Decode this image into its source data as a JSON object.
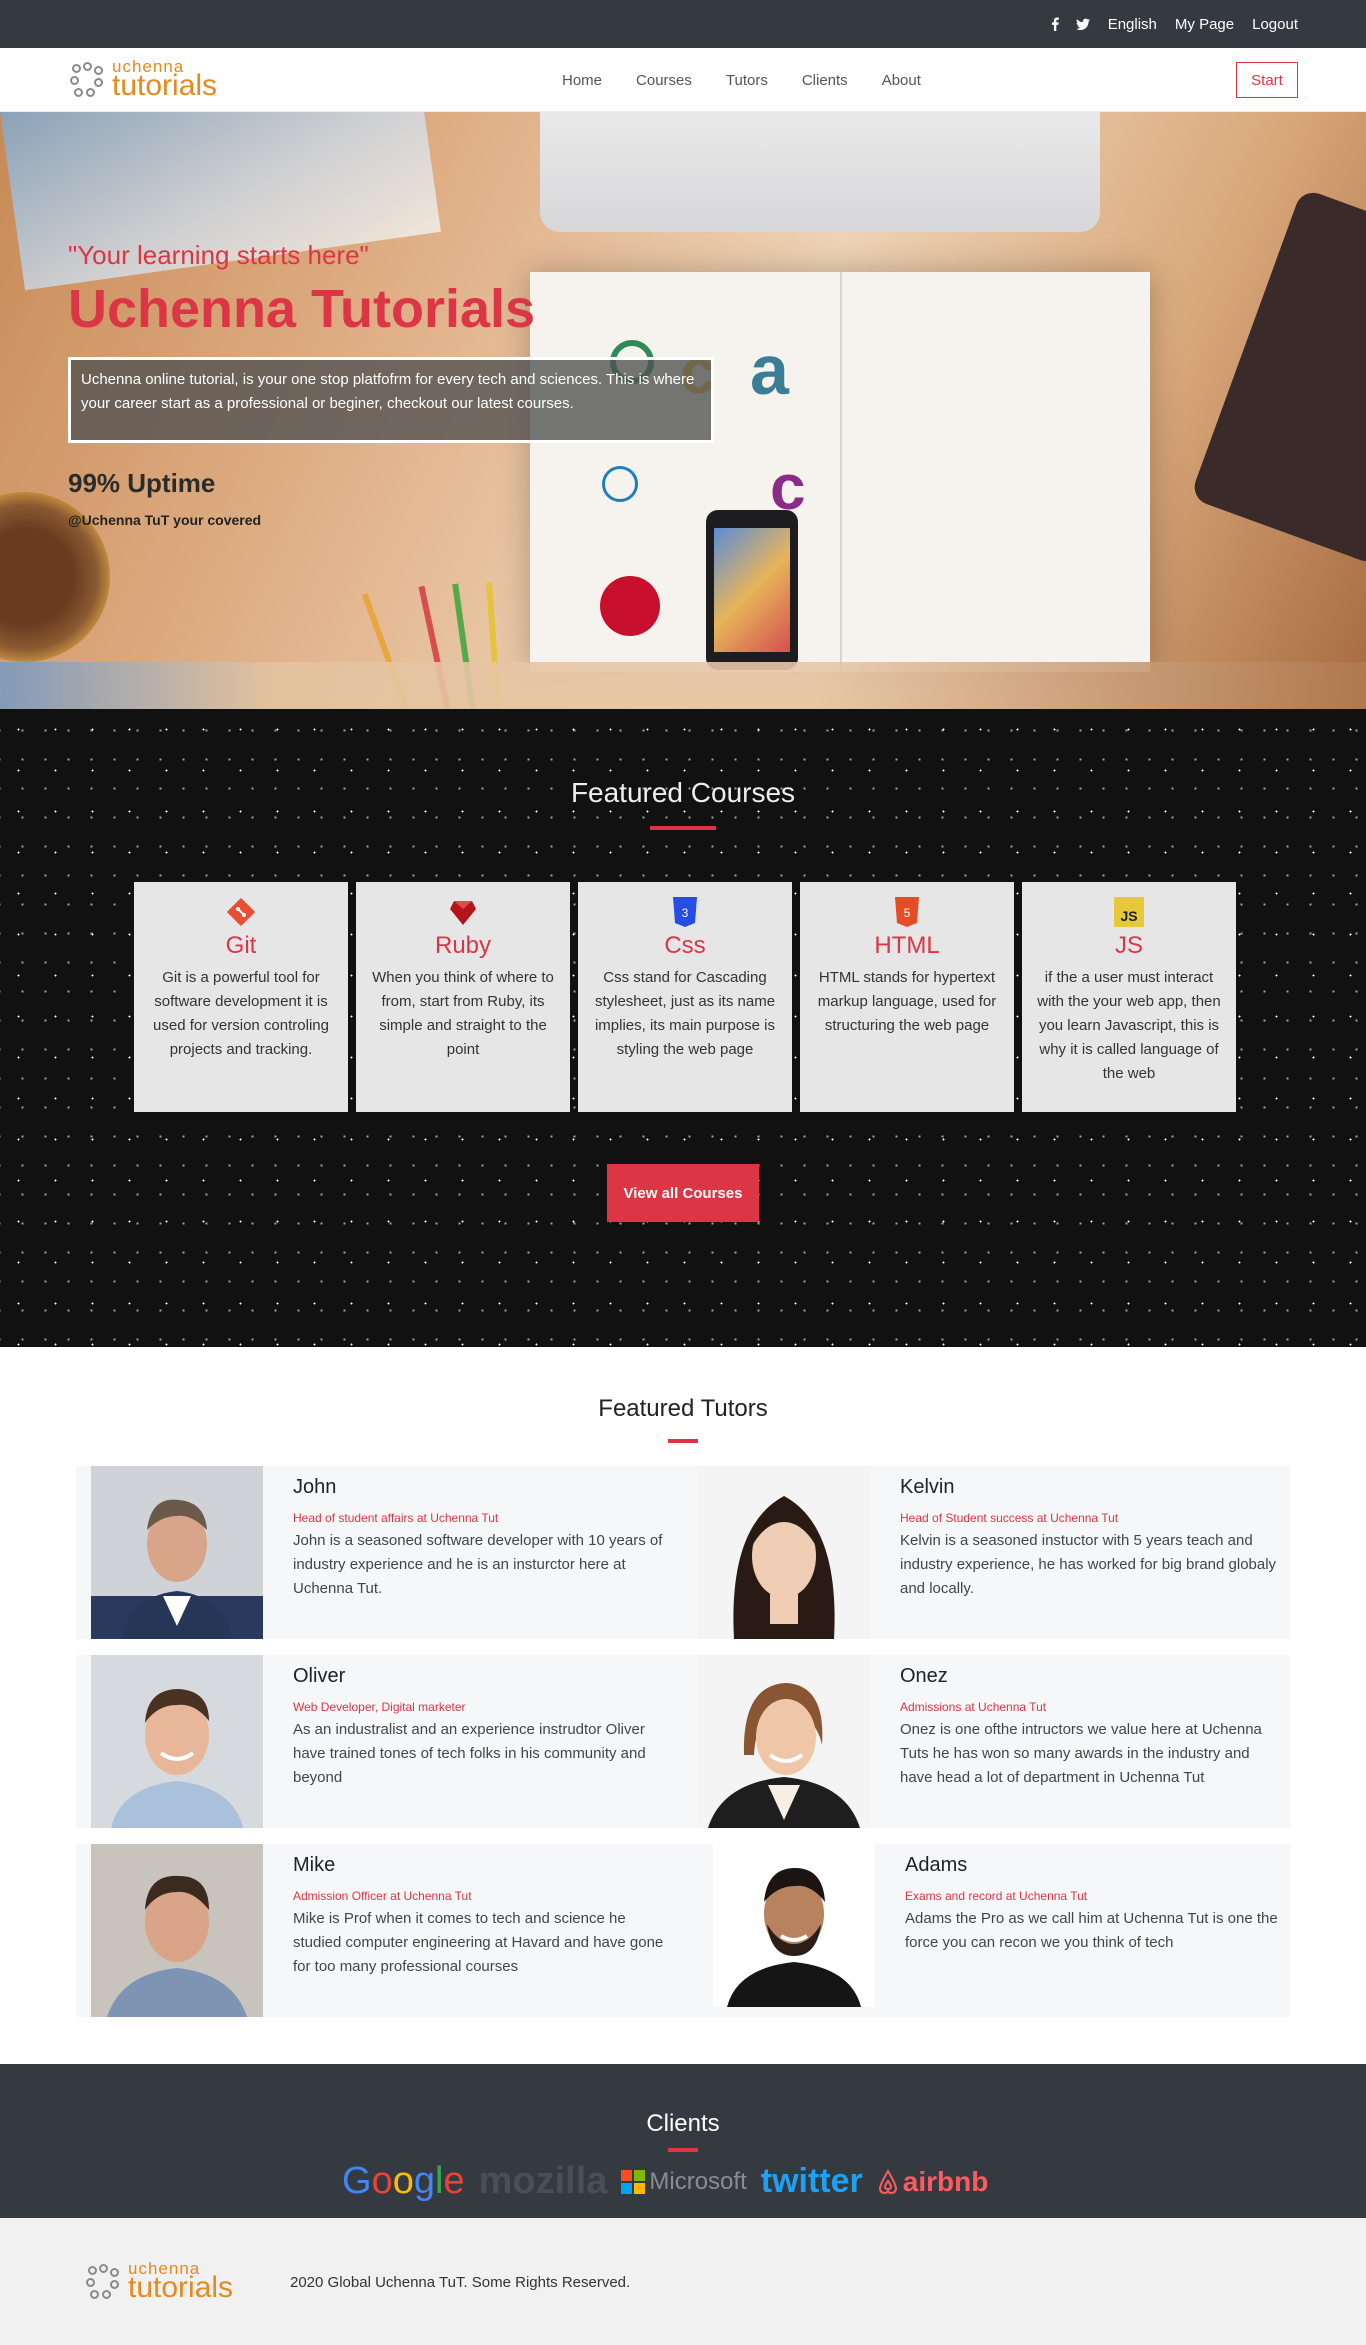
{
  "topbar": {
    "social": [
      "facebook-icon",
      "twitter-icon"
    ],
    "links": [
      "English",
      "My Page",
      "Logout"
    ]
  },
  "brand": {
    "line1": "uchenna",
    "line2": "tutorials"
  },
  "nav": {
    "links": [
      "Home",
      "Courses",
      "Tutors",
      "Clients",
      "About"
    ],
    "start": "Start"
  },
  "hero": {
    "tagline": "\"Your learning starts here\"",
    "title": "Uchenna Tutorials",
    "description": "Uchenna online tutorial, is your one stop platfofrm for every tech and sciences. This is where your career start as a professional or beginer, checkout our latest courses.",
    "uptime": "99% Uptime",
    "covered": "@Uchenna TuT your covered"
  },
  "courses": {
    "title": "Featured Courses",
    "items": [
      {
        "name": "Git",
        "icon": "git-icon",
        "color": "#e84e31",
        "text": "Git is a powerful tool for software development it is used for version controling projects and tracking."
      },
      {
        "name": "Ruby",
        "icon": "ruby-icon",
        "color": "#b3151b",
        "text": "When you think of where to from, start from Ruby, its simple and straight to the point"
      },
      {
        "name": "Css",
        "icon": "css3-icon",
        "color": "#264de4",
        "text": "Css stand for Cascading stylesheet, just as its name implies, its main purpose is styling the web page"
      },
      {
        "name": "HTML",
        "icon": "html5-icon",
        "color": "#e44d26",
        "text": "HTML stands for hypertext markup language, used for structuring the web page"
      },
      {
        "name": "JS",
        "icon": "js-icon",
        "color": "#e6c83a",
        "text": "if the a user must interact with the your web app, then you learn Javascript, this is why it is called language of the web"
      }
    ],
    "view_all": "View all Courses"
  },
  "tutors": {
    "title": "Featured Tutors",
    "rows": [
      [
        {
          "name": "John",
          "role": "Head of student affairs at Uchenna Tut",
          "bio": "John is a seasoned software developer with 10 years of industry experience and he is an insturctor here at Uchenna Tut."
        },
        {
          "name": "Kelvin",
          "role": "Head of Student success at Uchenna Tut",
          "bio": "Kelvin is a seasoned instuctor with 5 years teach and industry experience, he has worked for big brand globaly and locally."
        }
      ],
      [
        {
          "name": "Oliver",
          "role": "Web Developer, Digital marketer",
          "bio": "As an industralist and an experience instrudtor Oliver have trained tones of tech folks in his community and beyond"
        },
        {
          "name": "Onez",
          "role": "Admissions at Uchenna Tut",
          "bio": "Onez is one ofthe intructors we value here at Uchenna Tuts he has won so many awards in the industry and have head a lot of department in Uchenna Tut"
        }
      ],
      [
        {
          "name": "Mike",
          "role": "Admission Officer at Uchenna Tut",
          "bio": "Mike is Prof when it comes to tech and science he studied computer engineering at Havard and have gone for too many professional courses"
        },
        {
          "name": "Adams",
          "role": "Exams and record at Uchenna Tut",
          "bio": "Adams the Pro as we call him at Uchenna Tut is one the force you can recon we you think of tech"
        }
      ]
    ]
  },
  "clients": {
    "title": "Clients",
    "logos": [
      "Google",
      "mozilla",
      "Microsoft",
      "twitter",
      "airbnb"
    ]
  },
  "footer": {
    "copyright": "2020 Global Uchenna TuT. Some Rights Reserved."
  }
}
